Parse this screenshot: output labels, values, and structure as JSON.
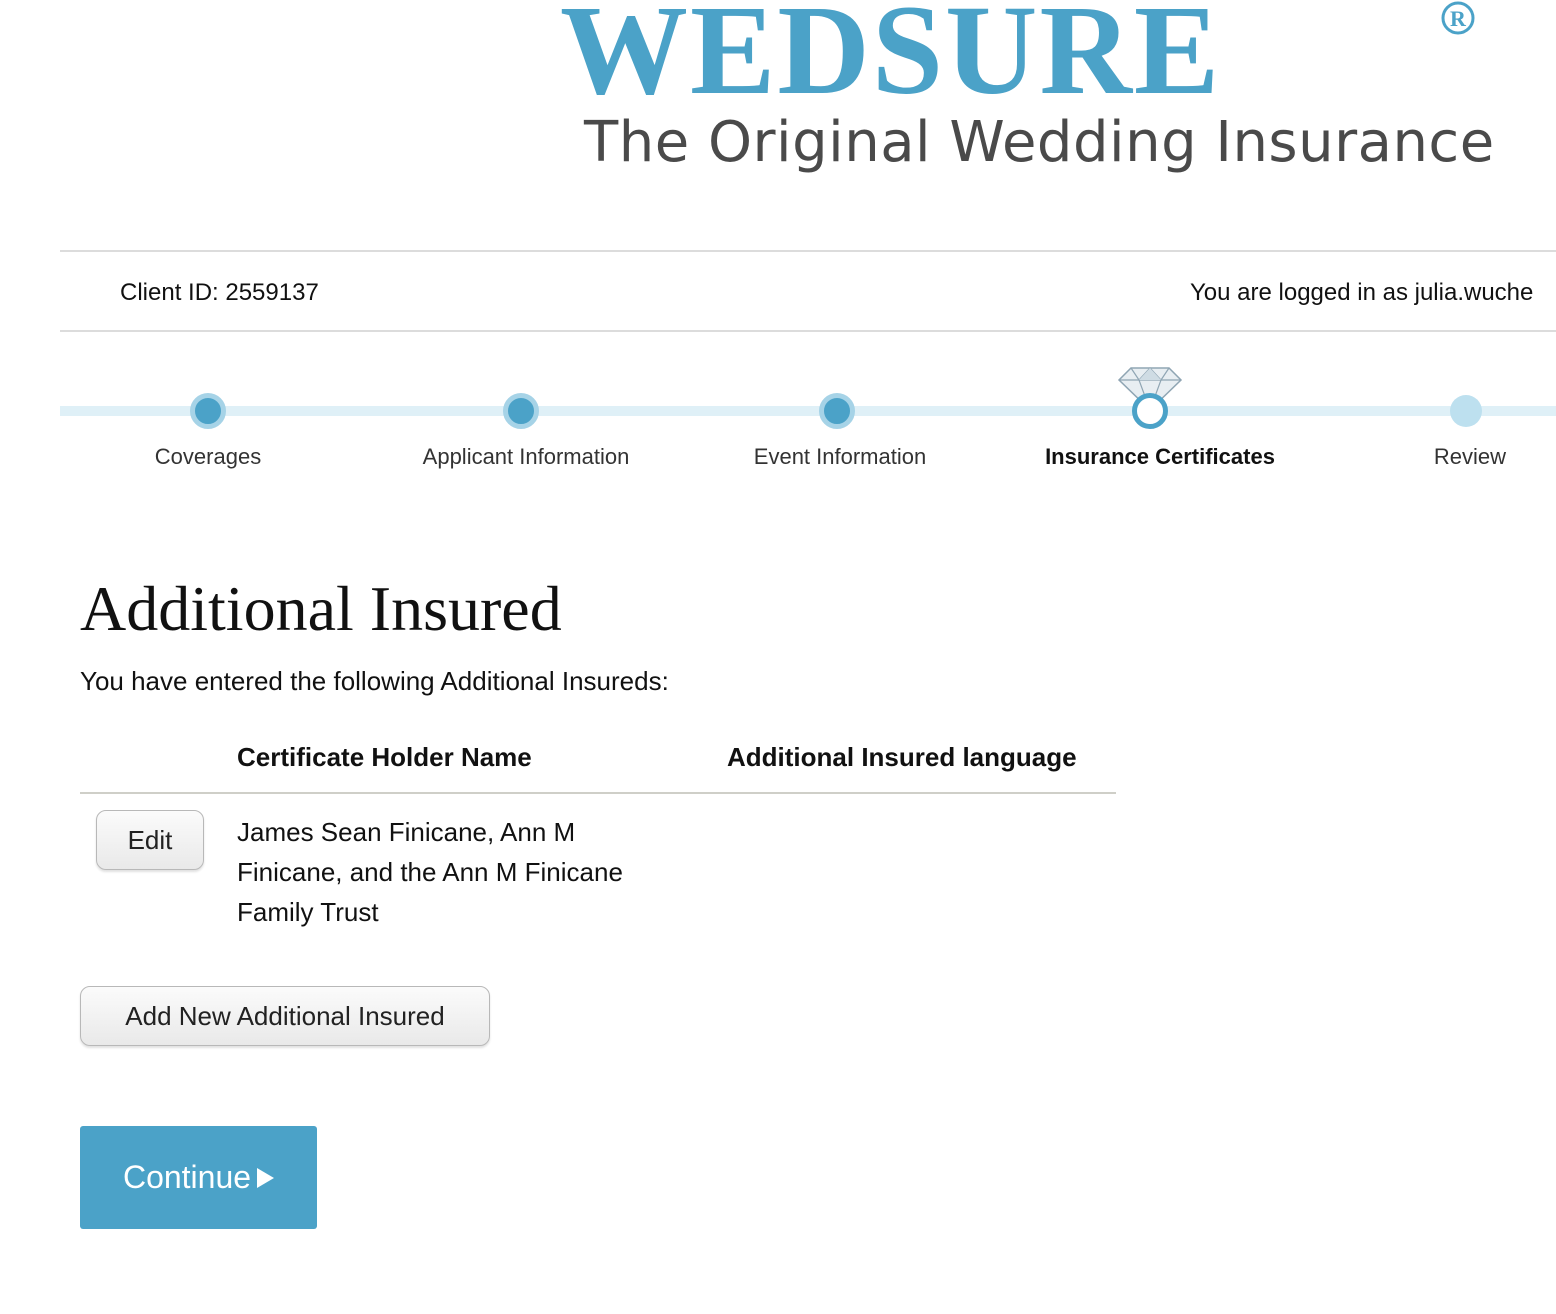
{
  "brand": {
    "name": "WEDSURE",
    "registered_mark": "R",
    "tagline": "The Original Wedding Insurance"
  },
  "info_bar": {
    "client_id": "Client ID: 2559137",
    "logged_in": "You are logged in as julia.wuche"
  },
  "steps": [
    {
      "label": "Coverages",
      "status": "done"
    },
    {
      "label": "Applicant Information",
      "status": "done"
    },
    {
      "label": "Event Information",
      "status": "done"
    },
    {
      "label": "Insurance Certificates",
      "status": "current"
    },
    {
      "label": "Review",
      "status": "future"
    }
  ],
  "main": {
    "title": "Additional Insured",
    "intro": "You have entered the following Additional Insureds:",
    "table": {
      "headers": {
        "holder": "Certificate Holder Name",
        "language": "Additional Insured language"
      },
      "rows": [
        {
          "edit_label": "Edit",
          "holder_name": "James Sean Finicane, Ann M Finicane, and the Ann M Finicane Family Trust",
          "language": ""
        }
      ]
    },
    "add_button": "Add New Additional Insured",
    "continue_button": "Continue"
  },
  "colors": {
    "accent": "#4ba2c8",
    "track": "#dff0f7",
    "tagline": "#4a4a4a"
  },
  "icons": {
    "current_step": "diamond-ring-icon",
    "continue": "play-arrow-icon"
  }
}
